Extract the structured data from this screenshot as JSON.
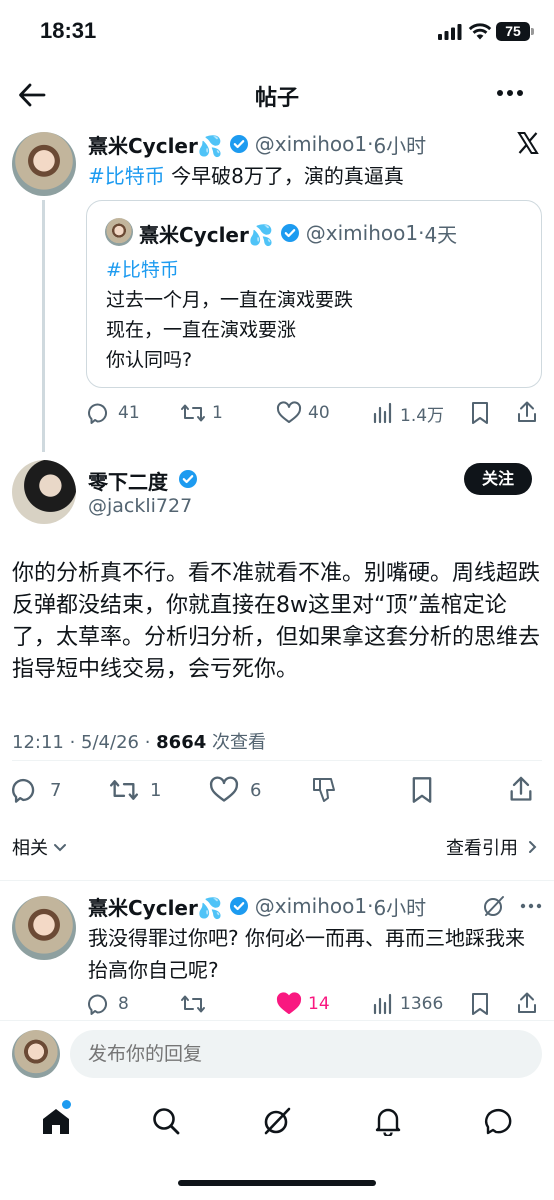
{
  "status": {
    "time": "18:31",
    "battery": "75"
  },
  "header": {
    "title": "帖子"
  },
  "parent_post": {
    "name": "熹米Cycler💦",
    "handle": "@ximihoo1",
    "sep": "·",
    "time": "6小时",
    "hashtag": "#比特币",
    "text": " 今早破8万了，演的真逼真"
  },
  "quote": {
    "name": "熹米Cycler💦",
    "handle": "@ximihoo1",
    "sep": "·",
    "time": "4天",
    "hashtag": "#比特币",
    "lines": [
      "过去一个月，一直在演戏要跌",
      "现在，一直在演戏要涨",
      "你认同吗?"
    ]
  },
  "parent_actions": {
    "replies": "41",
    "reposts": "1",
    "likes": "40",
    "views": "1.4万"
  },
  "main_post": {
    "name": "零下二度",
    "handle": "@jackli727",
    "follow_label": "关注",
    "text": "你的分析真不行。看不准就看不准。别嘴硬。周线超跌反弹都没结束，你就直接在8w这里对“顶”盖棺定论了，太草率。分析归分析，但如果拿这套分析的思维去指导短中线交易，会亏死你。",
    "meta_time": "12:11 · 5/4/26 · ",
    "meta_views": "8664",
    "meta_views_label": " 次查看",
    "replies": "7",
    "reposts": "1",
    "likes": "6",
    "related_label": "相关",
    "quotes_label": "查看引用"
  },
  "reply_post": {
    "name": "熹米Cycler💦",
    "handle": "@ximihoo1",
    "sep": "·",
    "time": "6小时",
    "text": "我没得罪过你吧? 你何必一而再、再而三地踩我来抬高你自己呢?",
    "replies": "8",
    "reposts": "",
    "likes": "14",
    "views": "1366"
  },
  "composer": {
    "placeholder": "发布你的回复"
  },
  "colors": {
    "accent": "#1d9bf0",
    "like": "#f91880",
    "text": "#0f1419",
    "muted": "#536471"
  }
}
